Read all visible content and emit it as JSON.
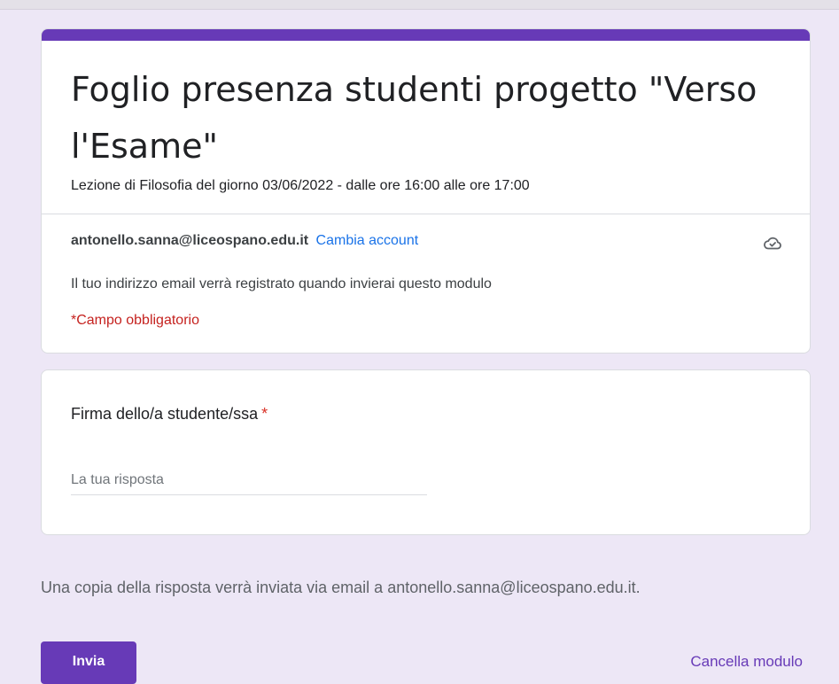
{
  "form": {
    "title": "Foglio presenza studenti progetto \"Verso l'Esame\"",
    "description": "Lezione di Filosofia del giorno 03/06/2022 - dalle ore 16:00 alle ore 17:00",
    "accent_color": "#673ab7"
  },
  "account": {
    "email": "antonello.sanna@liceospano.edu.it",
    "switch_label": "Cambia account",
    "cloud_icon": "cloud-done-icon",
    "email_note": "Il tuo indirizzo email verrà registrato quando invierai questo modulo",
    "required_note": "*Campo obbligatorio"
  },
  "question": {
    "label": "Firma dello/a studente/ssa",
    "required_mark": "*",
    "placeholder": "La tua risposta",
    "value": ""
  },
  "footer": {
    "copy_note": "Una copia della risposta verrà inviata via email a antonello.sanna@liceospano.edu.it.",
    "submit_label": "Invia",
    "clear_label": "Cancella modulo"
  }
}
